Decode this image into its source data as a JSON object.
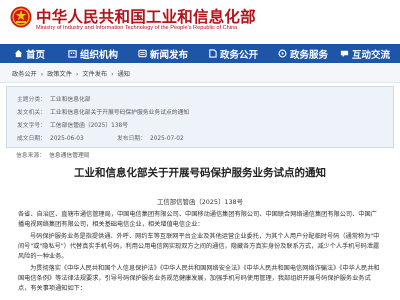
{
  "header": {
    "title": "中华人民共和国工业和信息化部",
    "subtitle": "Ministry of Industry and Information Technology of the People's Republic of China",
    "emblem_icon": "national-emblem-icon"
  },
  "nav": {
    "items": [
      {
        "label": "首页",
        "icon": "home-icon"
      },
      {
        "label": "组织机构",
        "icon": "org-icon"
      },
      {
        "label": "新闻发布",
        "icon": "news-icon"
      },
      {
        "label": "政务公开",
        "icon": "public-icon"
      },
      {
        "label": "政务服务",
        "icon": "service-icon"
      },
      {
        "label": "互动交流",
        "icon": "interact-icon"
      }
    ],
    "bg_color": "#1d56a8"
  },
  "breadcrumb": {
    "items": [
      "政务公开",
      "政策文件",
      "文件发布",
      "通知"
    ],
    "separator": "›"
  },
  "info": {
    "category_label": "主题分类：",
    "category_value": "工业和信息化部",
    "issuer_label": "发文机关：",
    "issuer_value": "工业和信息化部关于开展号码保护服务业务试点的通知",
    "number_label": "发文字号：",
    "number_value": "工信部信管函〔2025〕138号",
    "date_label": "成文日期：",
    "date_value": "2025-06-03",
    "pub_label": "发布日期：",
    "pub_value": "2025-07-02",
    "source_label": "信息来源：",
    "source_value": "信息通信管理局"
  },
  "document": {
    "title": "工业和信息化部关于开展号码保护服务业务试点的通知",
    "number": "工信部信管函〔2025〕138号",
    "paragraphs": [
      "各省、自治区、直辖市通信管理局，中国电信集团有限公司、中国移动通信集团有限公司、中国联合网络通信集团有限公司、中国广播电视网络集团有限公司，相关基础电信企业，相关增值电信企业：",
      "号码保护服务业务是指提供通、外呼、网约车等互联网平台企业及其他运营企业委托，为其个人用户分配临时号码（通常称为\"中间号\"或\"隐私号\"）代替真实手机号码，利用公用电信网实现双方之间的通信，隐藏各方真实身份及联系方式，减少个人手机号码泄露风险的一种业务。",
      "为贯彻落实《中华人民共和国个人信息保护法》《中华人民共和国网络安全法》《中华人民共和国电信网络诈骗法》《中华人民共和国电信条例》等法律法规要求，引导号码保护服务业务规范健康发展，加强手机号码使用管理，我部组织开展号码保护服务业务试点，有关事项通知如下："
    ]
  }
}
